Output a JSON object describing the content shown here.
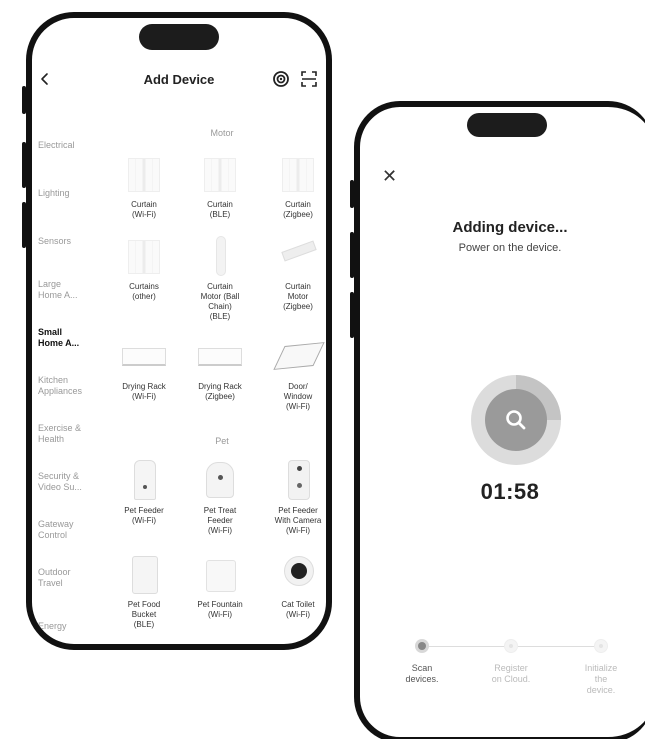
{
  "left_screen": {
    "title": "Add Device",
    "categories": [
      {
        "label": "Electrical",
        "active": false
      },
      {
        "label": "Lighting",
        "active": false
      },
      {
        "label": "Sensors",
        "active": false
      },
      {
        "label": "Large\nHome A...",
        "active": false
      },
      {
        "label": "Small\nHome A...",
        "active": true
      },
      {
        "label": "Kitchen\nAppliances",
        "active": false
      },
      {
        "label": "Exercise &\nHealth",
        "active": false
      },
      {
        "label": "Security &\nVideo Su...",
        "active": false
      },
      {
        "label": "Gateway\nControl",
        "active": false
      },
      {
        "label": "Outdoor\nTravel",
        "active": false
      },
      {
        "label": "Energy",
        "active": false
      }
    ],
    "sections": {
      "motor": "Motor",
      "pet": "Pet"
    },
    "devices": [
      {
        "label": "Curtain\n(Wi-Fi)",
        "icon": "curtain"
      },
      {
        "label": "Curtain\n(BLE)",
        "icon": "curtain"
      },
      {
        "label": "Curtain\n(Zigbee)",
        "icon": "curtain"
      },
      {
        "label": "Curtains\n(other)",
        "icon": "curtain"
      },
      {
        "label": "Curtain\nMotor (Ball\nChain)\n(BLE)",
        "icon": "motorbar"
      },
      {
        "label": "Curtain\nMotor\n(Zigbee)",
        "icon": "tube"
      },
      {
        "label": "Drying Rack\n(Wi-Fi)",
        "icon": "rack"
      },
      {
        "label": "Drying Rack\n(Zigbee)",
        "icon": "rack"
      },
      {
        "label": "Door/\nWindow\n(Wi-Fi)",
        "icon": "window"
      },
      {
        "label": "Pet Feeder\n(Wi-Fi)",
        "icon": "feeder"
      },
      {
        "label": "Pet Treat\nFeeder\n(Wi-Fi)",
        "icon": "treat"
      },
      {
        "label": "Pet Feeder\nWith Camera\n(Wi-Fi)",
        "icon": "cam-feeder"
      },
      {
        "label": "Pet Food\nBucket\n(BLE)",
        "icon": "bucket"
      },
      {
        "label": "Pet Fountain\n(Wi-Fi)",
        "icon": "fountain"
      },
      {
        "label": "Cat Toilet\n(Wi-Fi)",
        "icon": "toilet"
      }
    ]
  },
  "right_screen": {
    "title": "Adding device...",
    "subtitle": "Power on the device.",
    "timer": "01:58",
    "steps": [
      {
        "label": "Scan\ndevices.",
        "active": true
      },
      {
        "label": "Register\non Cloud.",
        "active": false
      },
      {
        "label": "Initialize\nthe\ndevice.",
        "active": false
      }
    ]
  }
}
